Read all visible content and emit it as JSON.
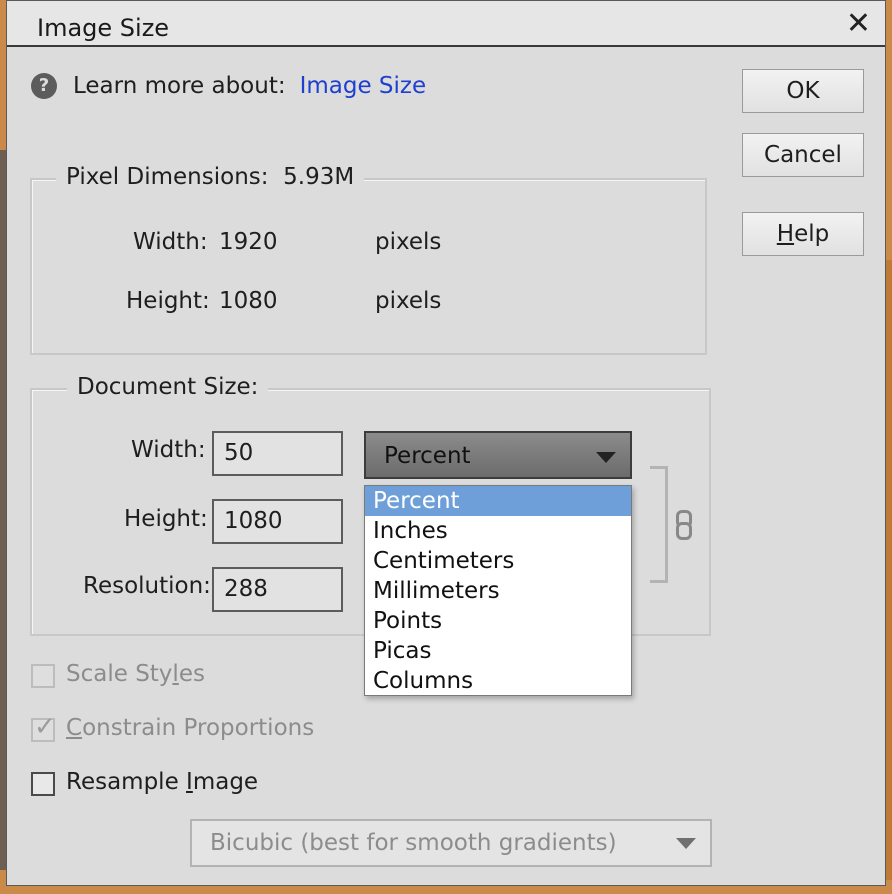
{
  "window": {
    "title": "Image Size"
  },
  "help": {
    "prefix": "Learn more about:",
    "link": "Image Size"
  },
  "buttons": {
    "ok": "OK",
    "cancel": "Cancel",
    "help_prefix": "",
    "help_underlined": "H",
    "help_rest": "elp"
  },
  "pixel_dimensions": {
    "legend": "Pixel Dimensions:",
    "size": "5.93M",
    "width_label": "Width:",
    "width_value": "1920",
    "width_unit": "pixels",
    "height_label": "Height:",
    "height_value": "1080",
    "height_unit": "pixels"
  },
  "document_size": {
    "legend": "Document Size:",
    "width_label": "Width:",
    "width_value": "50",
    "height_label": "Height:",
    "height_value": "1080",
    "resolution_label": "Resolution:",
    "resolution_value": "288",
    "unit_selected": "Percent",
    "unit_options": [
      "Percent",
      "Inches",
      "Centimeters",
      "Millimeters",
      "Points",
      "Picas",
      "Columns"
    ]
  },
  "options": {
    "scale_styles": {
      "pre": "Scale Sty",
      "underlined": "l",
      "post": "es",
      "checked": false,
      "enabled": false
    },
    "constrain": {
      "pre": "",
      "underlined": "C",
      "post": "onstrain Proportions",
      "checked": true,
      "enabled": false
    },
    "resample": {
      "pre": "Resample ",
      "underlined": "I",
      "post": "mage",
      "checked": false,
      "enabled": true
    }
  },
  "resample_method": "Bicubic (best for smooth gradients)",
  "icons": {
    "help": "question-circle-icon",
    "close": "close-icon",
    "dropdown": "chevron-down-icon",
    "link": "chain-link-icon",
    "check": "check-icon"
  },
  "colors": {
    "link": "#1e3fd0",
    "selected_option": "#6f9fd8",
    "disabled_text": "#8c8c8c"
  }
}
